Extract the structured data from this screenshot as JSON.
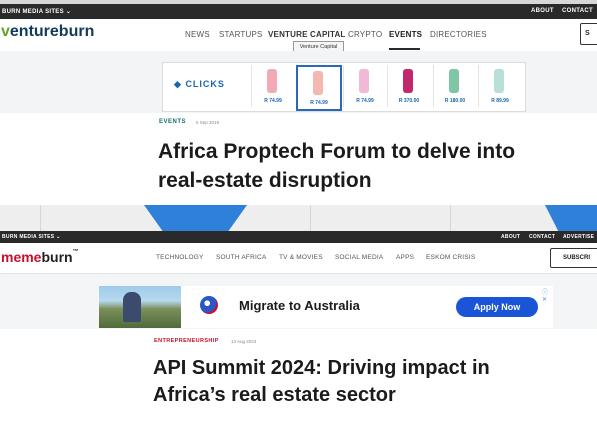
{
  "ventureburn": {
    "topbar": {
      "media_sites": "BURN MEDIA SITES ⌄",
      "about": "ABOUT",
      "contact": "CONTACT"
    },
    "logo": {
      "accent": "v",
      "rest": "entureburn"
    },
    "nav": [
      "NEWS",
      "STARTUPS",
      "VENTURE CAPITAL",
      "CRYPTO",
      "EVENTS",
      "DIRECTORIES"
    ],
    "active_nav": "EVENTS",
    "tooltip": "Venture Capital",
    "subscribe_label": "S",
    "ad": {
      "brand": "CLICKS",
      "brand_mark": "◆",
      "products": [
        {
          "price": "R 74.99",
          "color": "#f2a9b6"
        },
        {
          "price": "R 74.99",
          "color": "#f5b8b0"
        },
        {
          "price": "R 74.99",
          "color": "#f0b9d6"
        },
        {
          "price": "R 370.00",
          "color": "#c02a6a"
        },
        {
          "price": "R 180.00",
          "color": "#7ec6a6"
        },
        {
          "price": "R 89.99",
          "color": "#b8e0d8"
        }
      ]
    },
    "article": {
      "category": "EVENTS",
      "date": "5 Sep 2019",
      "title_line1": "Africa Proptech Forum to delve into",
      "title_line2": "real-estate disruption"
    }
  },
  "memeburn": {
    "topbar": {
      "media_sites": "BURN MEDIA SITES ⌄",
      "about": "ABOUT",
      "contact": "CONTACT",
      "advertise": "ADVERTISE"
    },
    "logo": {
      "accent": "meme",
      "rest": "burn",
      "tm": "™"
    },
    "nav": [
      "TECHNOLOGY",
      "SOUTH AFRICA",
      "TV & MOVIES",
      "SOCIAL MEDIA",
      "APPS",
      "ESKOM CRISIS"
    ],
    "subscribe_label": "SUBSCRI",
    "ad": {
      "headline": "Migrate to Australia",
      "cta": "Apply Now",
      "close": "ⓘ ✕"
    },
    "article": {
      "category": "ENTREPRENEURSHIP",
      "date": "13 Aug 2024",
      "title_line1": "API Summit 2024: Driving impact in",
      "title_line2": "Africa’s real estate sector"
    }
  },
  "colors": {
    "ventureburn_accent": "#6aa230",
    "memeburn_accent": "#c8102e",
    "band_blue": "#2f80d8",
    "ad_button": "#1a55d8"
  }
}
